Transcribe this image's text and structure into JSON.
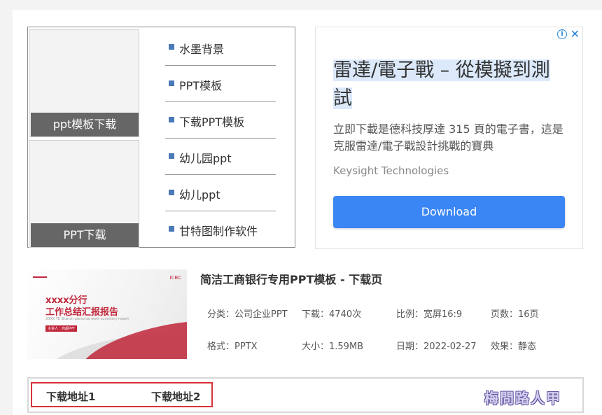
{
  "sidebar": {
    "thumbnails": [
      {
        "caption": "ppt模板下载"
      },
      {
        "caption": "PPT下载"
      }
    ],
    "links": [
      {
        "label": "水墨背景"
      },
      {
        "label": "PPT模板"
      },
      {
        "label": "下载PPT模板"
      },
      {
        "label": "幼儿园ppt"
      },
      {
        "label": "幼儿ppt"
      },
      {
        "label": "甘特图制作软件"
      }
    ]
  },
  "ad": {
    "headline": "雷達/電子戰 – 從模擬到測試",
    "body": "立即下載是德科技厚達 315 頁的電子書，這是克服雷達/電子戰設計挑戰的寶典",
    "brand": "Keysight Technologies",
    "cta": "Download",
    "adchoices_glyph": "i",
    "close_glyph": "✕"
  },
  "item": {
    "title": "简洁工商银行专用PPT模板 - 下载页",
    "preview": {
      "line1": "xxxx分行",
      "line2": "工作总结汇报报告",
      "line3": "20XX YE Branch personal work summary report",
      "line4": "主讲人：商超PPT",
      "logo": "ICBC"
    },
    "meta": {
      "category": "分类：公司企业PPT",
      "downloads": "下载：4740次",
      "ratio": "比例：宽屏16:9",
      "pages": "页数：16页",
      "format": "格式：PPTX",
      "size": "大小：1.59MB",
      "date": "日期：2022-02-27",
      "effect": "效果：静态"
    }
  },
  "downloads": {
    "link1": "下载地址1",
    "link2": "下载地址2"
  },
  "watermark": "梅問路人甲",
  "colors": {
    "accent_blue": "#3b86f5",
    "link_bullet": "#4a79b8",
    "highlight_red": "#d8333b"
  }
}
